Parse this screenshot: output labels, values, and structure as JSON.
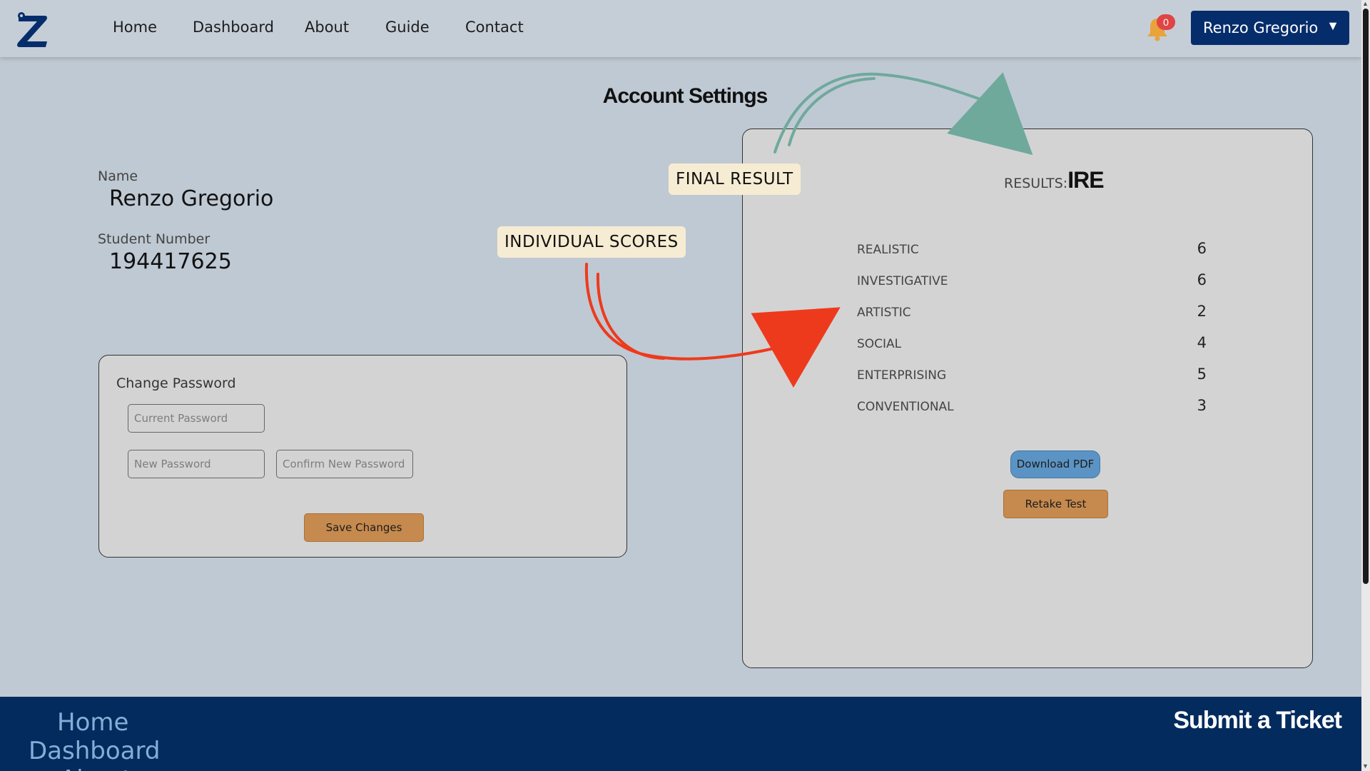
{
  "nav": {
    "links": [
      "Home",
      "Dashboard",
      "About",
      "Guide",
      "Contact"
    ],
    "notification_count": "0",
    "user_name": "Renzo Gregorio",
    "caret": "▼"
  },
  "page": {
    "title": "Account Settings"
  },
  "profile": {
    "name_label": "Name",
    "name_value": "Renzo Gregorio",
    "student_number_label": "Student Number",
    "student_number_value": "194417625"
  },
  "change_password": {
    "title": "Change Password",
    "current_placeholder": "Current Password",
    "new_placeholder": "New Password",
    "confirm_placeholder": "Confirm New Password",
    "save_label": "Save Changes"
  },
  "results": {
    "label": "RESULTS:",
    "code": "IRE",
    "scores": [
      {
        "name": "REALISTIC",
        "value": "6"
      },
      {
        "name": "INVESTIGATIVE",
        "value": "6"
      },
      {
        "name": "ARTISTIC",
        "value": "2"
      },
      {
        "name": "SOCIAL",
        "value": "4"
      },
      {
        "name": "ENTERPRISING",
        "value": "5"
      },
      {
        "name": "CONVENTIONAL",
        "value": "3"
      }
    ],
    "download_label": "Download PDF",
    "retake_label": "Retake Test"
  },
  "annotations": {
    "final_result": "FINAL RESULT",
    "individual_scores": "INDIVIDUAL SCORES"
  },
  "footer": {
    "links": [
      "Home",
      "Dashboard",
      "About"
    ],
    "ticket": "Submit a Ticket"
  },
  "colors": {
    "page_bg": "#bfc9d3",
    "nav_bg": "#c5ced7",
    "brand_navy": "#062d6b",
    "footer_bg": "#032b5e",
    "button_orange": "#c68a4e",
    "button_blue": "#5b94c4",
    "arrow_teal": "#6fa99c",
    "arrow_red": "#ee3a1c"
  },
  "icons": {
    "logo": "z-logo-icon",
    "notification": "bell-icon"
  }
}
